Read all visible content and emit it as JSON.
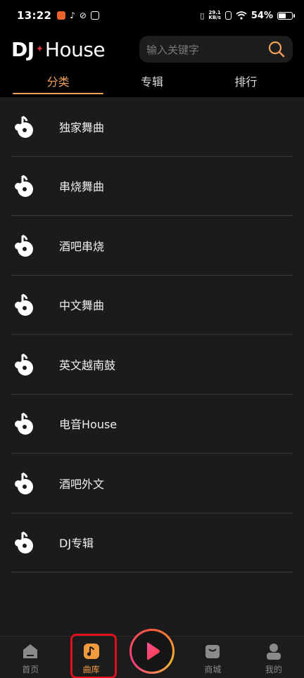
{
  "status_bar": {
    "time": "13:22",
    "net_speed_value": "29.1",
    "net_speed_unit": "KB/s",
    "battery": "54%",
    "battery_level": 0.54
  },
  "header": {
    "logo_dj": "DJ",
    "logo_house": "House",
    "search_placeholder": "输入关键字"
  },
  "tabs": [
    {
      "label": "分类",
      "active": true
    },
    {
      "label": "专辑",
      "active": false
    },
    {
      "label": "排行",
      "active": false
    }
  ],
  "categories": [
    {
      "label": "独家舞曲",
      "icon": "music-note-disc-icon"
    },
    {
      "label": "串烧舞曲",
      "icon": "music-note-disc-icon"
    },
    {
      "label": "酒吧串烧",
      "icon": "music-note-disc-icon"
    },
    {
      "label": "中文舞曲",
      "icon": "music-note-disc-icon"
    },
    {
      "label": "英文越南鼓",
      "icon": "music-note-disc-icon"
    },
    {
      "label": "电音House",
      "icon": "music-note-disc-icon"
    },
    {
      "label": "酒吧外文",
      "icon": "music-note-disc-icon"
    },
    {
      "label": "DJ专辑",
      "icon": "music-note-disc-icon"
    }
  ],
  "bottom_nav": [
    {
      "label": "首页",
      "icon": "home-icon",
      "active": false
    },
    {
      "label": "曲库",
      "icon": "music-library-icon",
      "active": true
    },
    {
      "label": "",
      "icon": "play-icon",
      "active": false
    },
    {
      "label": "商城",
      "icon": "shopping-bag-icon",
      "active": false
    },
    {
      "label": "我的",
      "icon": "user-icon",
      "active": false
    }
  ],
  "colors": {
    "accent": "#f2a15a",
    "logo_spark": "#e0303a",
    "highlight": "#e0101a",
    "panel_bg": "#1b1b1b"
  }
}
